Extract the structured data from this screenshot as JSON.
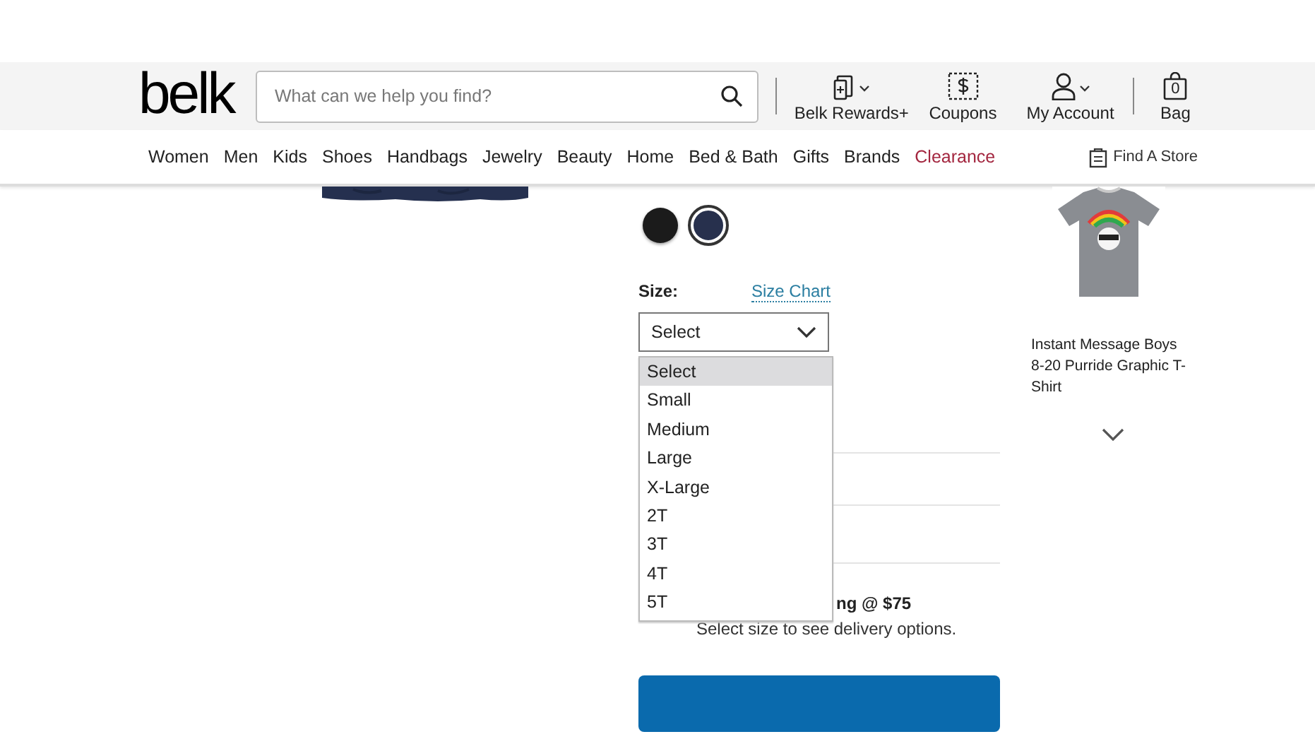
{
  "header": {
    "logo": "belk",
    "search": {
      "placeholder": "What can we help you find?"
    },
    "actions": [
      {
        "kind": "rewards",
        "label": "Belk Rewards+"
      },
      {
        "kind": "coupons",
        "label": "Coupons"
      },
      {
        "kind": "account",
        "label": "My Account"
      },
      {
        "kind": "bag",
        "label": "Bag",
        "count": "0"
      }
    ]
  },
  "nav": {
    "items": [
      {
        "label": "Women",
        "highlight": false
      },
      {
        "label": "Men",
        "highlight": false
      },
      {
        "label": "Kids",
        "highlight": false
      },
      {
        "label": "Shoes",
        "highlight": false
      },
      {
        "label": "Handbags",
        "highlight": false
      },
      {
        "label": "Jewelry",
        "highlight": false
      },
      {
        "label": "Beauty",
        "highlight": false
      },
      {
        "label": "Home",
        "highlight": false
      },
      {
        "label": "Bed & Bath",
        "highlight": false
      },
      {
        "label": "Gifts",
        "highlight": false
      },
      {
        "label": "Brands",
        "highlight": false
      },
      {
        "label": "Clearance",
        "highlight": true
      }
    ],
    "store_link": "Find A Store"
  },
  "product": {
    "swatches": [
      {
        "color": "#1b1b1b",
        "selected": false
      },
      {
        "color": "#27304d",
        "selected": true
      }
    ],
    "size_label": "Size:",
    "size_chart": "Size Chart",
    "size_select": {
      "value": "Select",
      "expanded": true
    },
    "size_options": [
      {
        "label": "Select",
        "selected": true
      },
      {
        "label": "Small",
        "selected": false
      },
      {
        "label": "Medium",
        "selected": false
      },
      {
        "label": "Large",
        "selected": false
      },
      {
        "label": "X-Large",
        "selected": false
      },
      {
        "label": "2T",
        "selected": false
      },
      {
        "label": "3T",
        "selected": false
      },
      {
        "label": "4T",
        "selected": false
      },
      {
        "label": "5T",
        "selected": false
      }
    ],
    "shipping_title": "ng @ $75",
    "shipping_note": "Select size to see delivery options."
  },
  "recommendation": {
    "title": "Instant Message Boys 8-20 Purride Graphic T-Shirt"
  }
}
